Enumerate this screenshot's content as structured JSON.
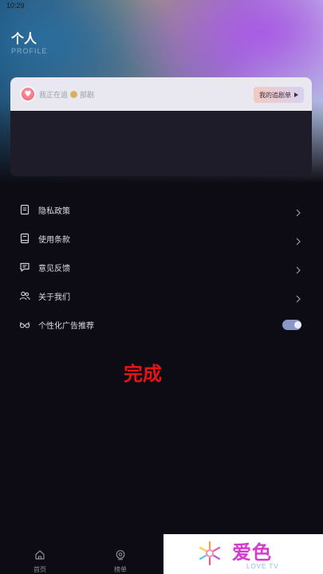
{
  "status_bar": {
    "time": "10:29"
  },
  "header": {
    "title": "个人",
    "subtitle": "PROFILE"
  },
  "watch_card": {
    "prefix": "我正在追",
    "suffix": "部剧",
    "button_label": "我的追剧单"
  },
  "menu": [
    {
      "label": "隐私政策",
      "icon": "document-icon",
      "trailing": "chevron"
    },
    {
      "label": "使用条款",
      "icon": "book-icon",
      "trailing": "chevron"
    },
    {
      "label": "意见反馈",
      "icon": "chat-icon",
      "trailing": "chevron"
    },
    {
      "label": "关于我们",
      "icon": "people-icon",
      "trailing": "chevron"
    },
    {
      "label": "个性化广告推荐",
      "icon": "glasses-icon",
      "trailing": "toggle",
      "enabled": true
    }
  ],
  "overlay": {
    "text": "完成",
    "color": "#e81414"
  },
  "tabbar": {
    "items": [
      {
        "label": "首页",
        "icon": "home-icon"
      },
      {
        "label": "榜单",
        "icon": "ranking-icon"
      }
    ]
  },
  "watermark": {
    "name": "爱色",
    "sub": "LOVE TV"
  },
  "colors": {
    "background": "#0d0c14",
    "accent_toggle": "#8a96c6",
    "brand": "#d63bd0"
  }
}
